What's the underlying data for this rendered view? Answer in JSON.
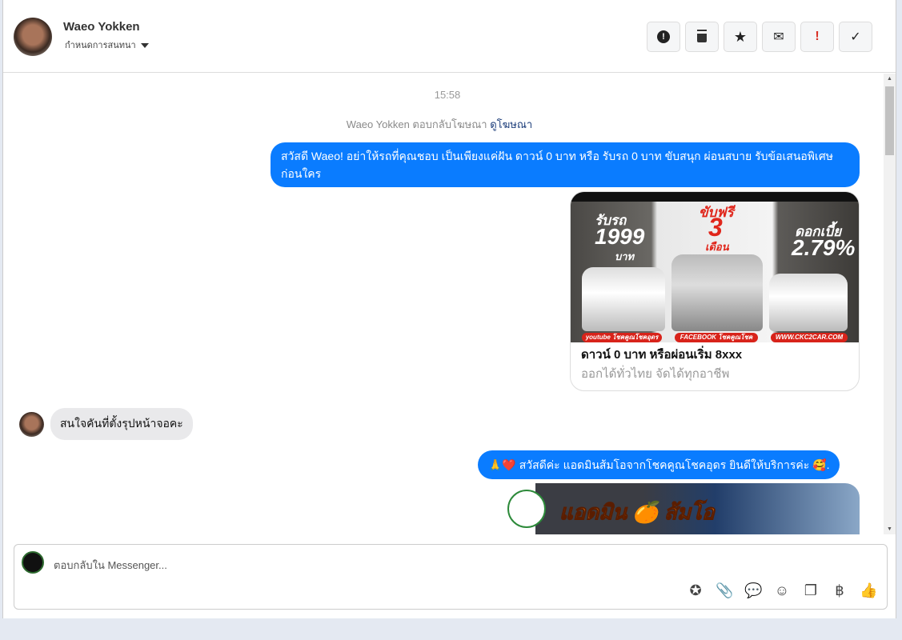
{
  "header": {
    "contact_name": "Waeo Yokken",
    "conversation_menu": "กำหนดการสนทนา",
    "actions": [
      {
        "name": "report-button",
        "icon": "alert-circle-icon",
        "glyph": "⬤"
      },
      {
        "name": "delete-button",
        "icon": "trash-icon",
        "glyph": "🗑"
      },
      {
        "name": "star-button",
        "icon": "star-icon",
        "glyph": "★"
      },
      {
        "name": "mark-unread-button",
        "icon": "envelope-icon",
        "glyph": "✉"
      },
      {
        "name": "important-button",
        "icon": "exclamation-icon",
        "glyph": "!"
      },
      {
        "name": "done-button",
        "icon": "check-icon",
        "glyph": "✓"
      }
    ]
  },
  "chat": {
    "timestamp": "15:58",
    "reply_notice": "Waeo Yokken ตอบกลับโฆษณา",
    "reply_link": "ดูโฆษณา",
    "msg1": "สวัสดี Waeo! อย่าให้รถที่คุณชอบ เป็นเพียงแค่ฝัน ดาวน์ 0 บาท หรือ รับรถ 0 บาท ขับสนุก ผ่อนสบาย รับข้อเสนอพิเศษก่อนใคร",
    "ad_card": {
      "title": "ดาวน์ 0 บาท หรือผ่อนเริ่ม 8xxx",
      "subtitle": "ออกได้ทั่วไทย จัดได้ทุกอาชีพ",
      "image_text": {
        "left_top": "รับรถ",
        "left_num": "1999",
        "left_unit": "บาท",
        "mid_top": "ขับฟรี",
        "mid_num": "3",
        "mid_unit": "เดือน",
        "right_top": "ดอกเบี้ย",
        "right_num": "2.79%",
        "tag1": "youtube โชคคูณโชคอุดร",
        "tag2": "FACEBOOK โชคคูณโชคอุดร",
        "tag3": "WWW.CKC2CAR.COM"
      }
    },
    "msg_in": "สนใจคันที่ตั้งรุปหน้าจอคะ",
    "msg2": "🙏❤️ สวัสดีค่ะ แอดมินส้มโอจากโชคคูณโชคอุดร ยินดีให้บริการค่ะ 🥰.",
    "ad2_text": "แอดมิน 🍊 ส้มโอ"
  },
  "composer": {
    "placeholder": "ตอบกลับใน Messenger...",
    "tools": [
      {
        "name": "saved-reply-icon",
        "glyph": "✪"
      },
      {
        "name": "attachment-icon",
        "glyph": "📎"
      },
      {
        "name": "quick-reply-icon",
        "glyph": "💬"
      },
      {
        "name": "emoji-icon",
        "glyph": "☺"
      },
      {
        "name": "catalog-icon",
        "glyph": "❐"
      },
      {
        "name": "payment-baht-icon",
        "glyph": "฿"
      },
      {
        "name": "like-icon",
        "glyph": "👍"
      }
    ]
  }
}
